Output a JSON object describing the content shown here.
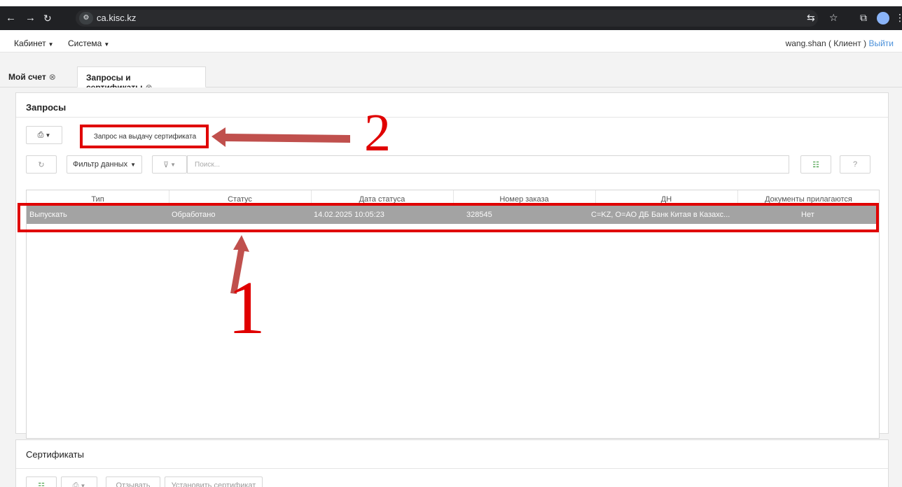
{
  "browser": {
    "url": "ca.kisc.kz"
  },
  "menubar": {
    "items": [
      {
        "label": "Кабинет"
      },
      {
        "label": "Система"
      }
    ],
    "user": "wang.shan ( Клиент )",
    "logout": "Выйти"
  },
  "tabs": [
    {
      "label": "Мой счет",
      "active": false
    },
    {
      "label": "Запросы и сертификаты",
      "active": true
    }
  ],
  "requests": {
    "title": "Запросы",
    "request_button": "Запрос на выдачу сертификата",
    "filter_button": "Фильтр данных",
    "search_placeholder": "Поиск...",
    "columns": [
      "Тип",
      "Статус",
      "Дата статуса",
      "Номер заказа",
      "ДН",
      "Документы прилагаются"
    ],
    "rows": [
      [
        "Выпускать",
        "Обработано",
        "14.02.2025 10:05:23",
        "328545",
        "C=KZ, O=АО ДБ Банк Китая в Казахс...",
        "Нет"
      ]
    ]
  },
  "certificates": {
    "title": "Сертификаты",
    "revoke_button": "Отзывать",
    "install_button": "Установить сертификат"
  },
  "annotations": {
    "label_1": "1",
    "label_2": "2",
    "color": "#e00000"
  }
}
